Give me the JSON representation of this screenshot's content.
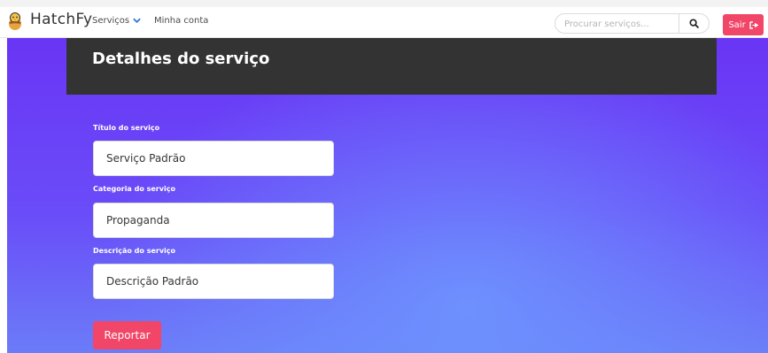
{
  "navbar": {
    "brand": "HatchFy",
    "services_label": "Serviços",
    "account_label": "Minha conta",
    "search": {
      "placeholder": "Procurar serviços...",
      "value": ""
    },
    "logout_label": "Sair"
  },
  "page": {
    "title": "Detalhes do serviço"
  },
  "form": {
    "fields": [
      {
        "label": "Título do serviço",
        "value": "Serviço Padrão"
      },
      {
        "label": "Categoria do serviço",
        "value": "Propaganda"
      },
      {
        "label": "Descrição do serviço",
        "value": "Descrição Padrão"
      }
    ],
    "report_label": "Reportar"
  },
  "icons": {
    "brand": "chick-logo-icon",
    "services_dropdown": "chevron-down-icon",
    "search": "search-icon",
    "logout": "sign-out-icon"
  },
  "colors": {
    "accent": "#f14668",
    "chevron": "#3273dc",
    "header_bar": "#333333",
    "gradient_top": "#6a35f5",
    "gradient_bottom": "#6b7cf8"
  }
}
